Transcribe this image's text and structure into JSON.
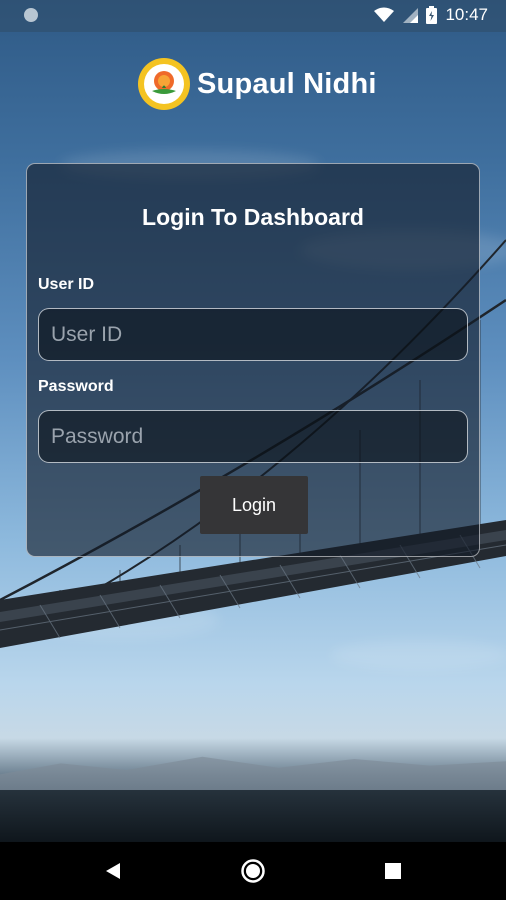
{
  "status_bar": {
    "time": "10:47",
    "icons": [
      "notification-dot-icon",
      "wifi-icon",
      "signal-icon",
      "battery-icon"
    ]
  },
  "brand": {
    "name": "Supaul Nidhi",
    "logo_icon": "cooperative-logo-icon"
  },
  "login": {
    "title": "Login To Dashboard",
    "user_id_label": "User ID",
    "user_id_placeholder": "User ID",
    "user_id_value": "",
    "password_label": "Password",
    "password_placeholder": "Password",
    "password_value": "",
    "button_label": "Login"
  },
  "nav_bar": {
    "icons": [
      "back-icon",
      "home-icon",
      "recents-icon"
    ]
  },
  "colors": {
    "card_background": "#141c28",
    "button_background": "#353537",
    "text": "#ffffff"
  }
}
